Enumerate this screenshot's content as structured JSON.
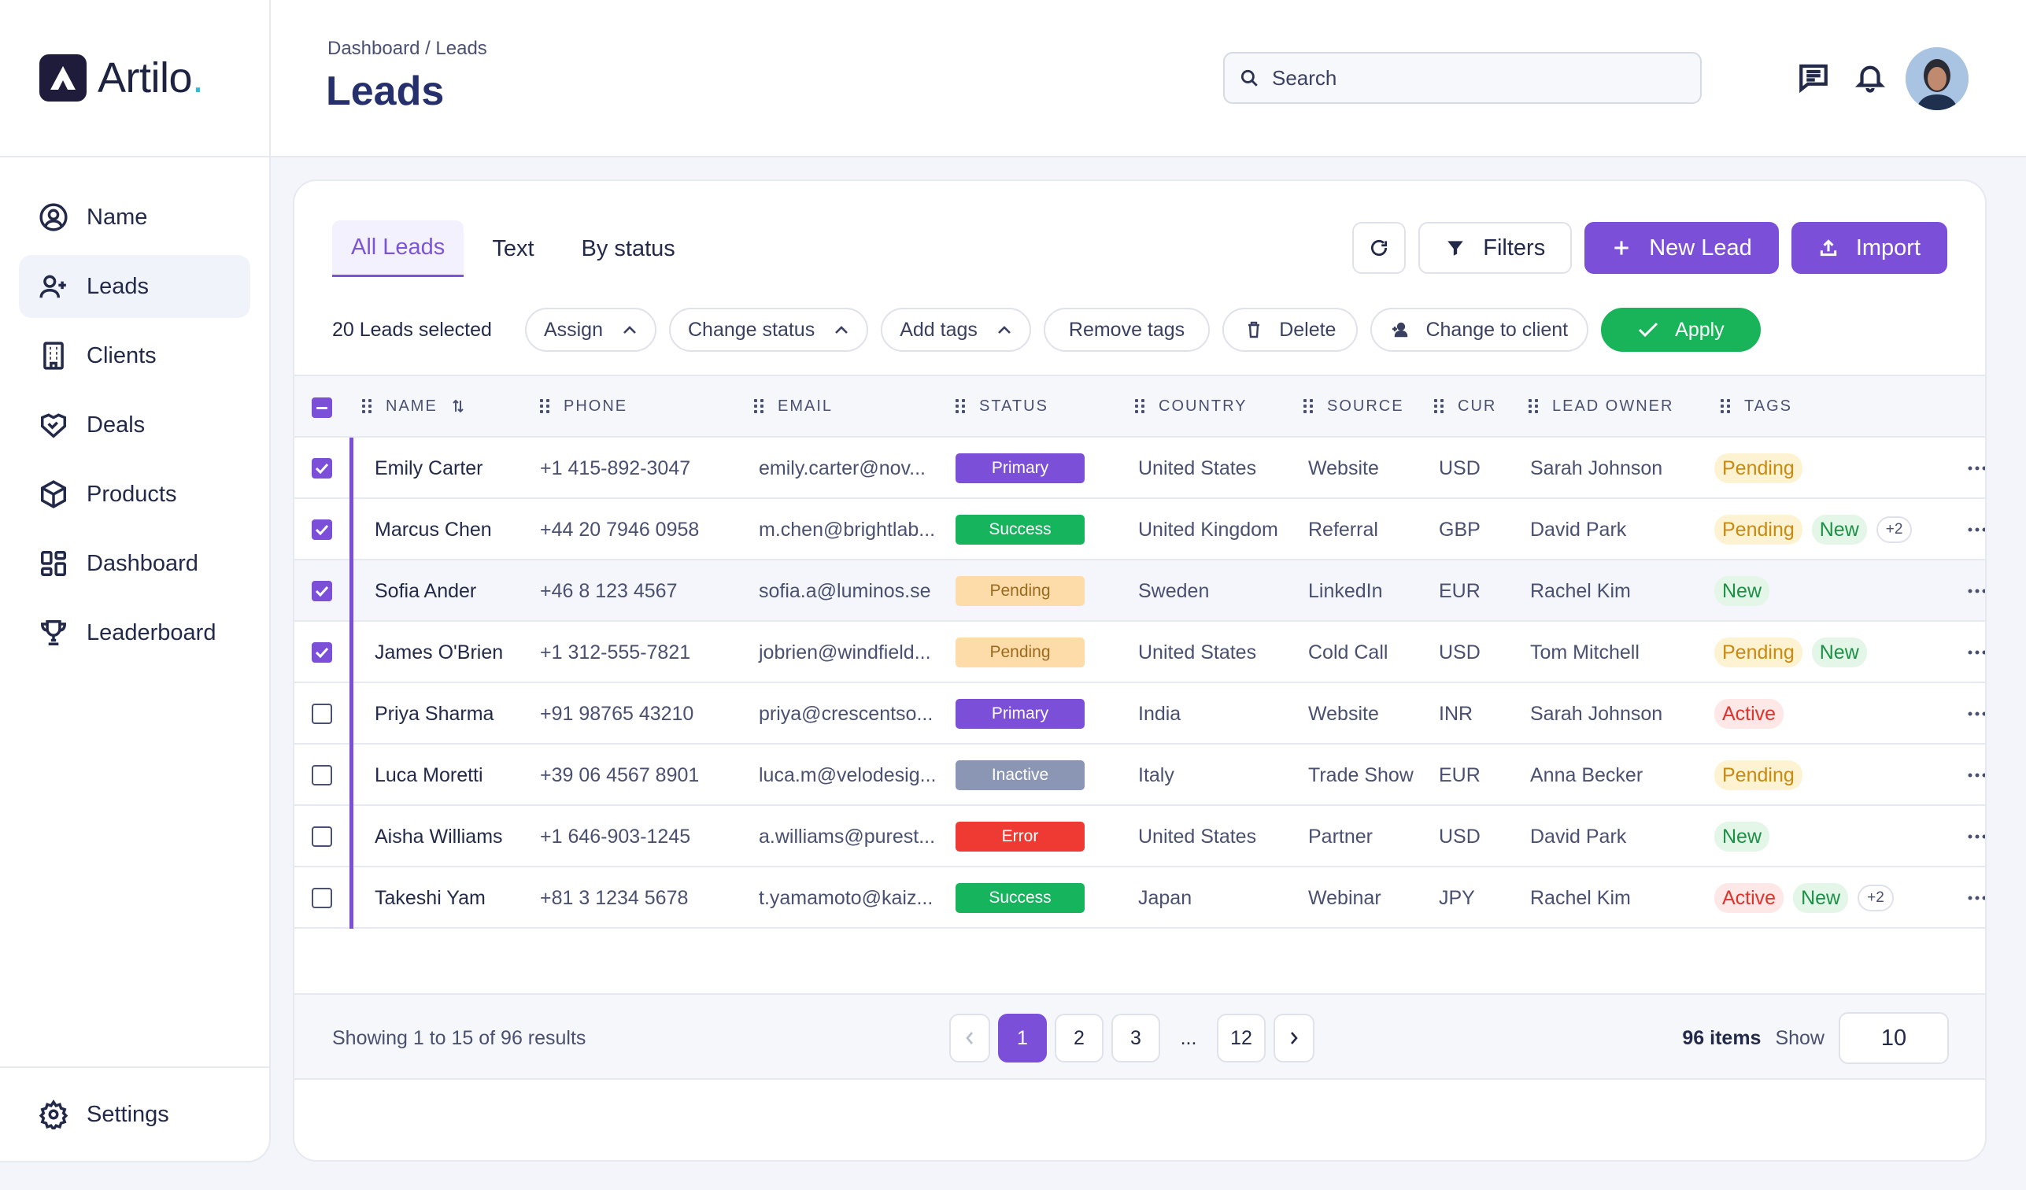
{
  "app": {
    "name": "Artilo",
    "dot": "."
  },
  "sidebar": {
    "items": [
      {
        "label": "Name",
        "icon": "user-circle-icon"
      },
      {
        "label": "Leads",
        "icon": "user-plus-icon"
      },
      {
        "label": "Clients",
        "icon": "building-icon"
      },
      {
        "label": "Deals",
        "icon": "handshake-icon"
      },
      {
        "label": "Products",
        "icon": "box-icon"
      },
      {
        "label": "Dashboard",
        "icon": "grid-icon"
      },
      {
        "label": "Leaderboard",
        "icon": "trophy-icon"
      }
    ],
    "active": "Leads",
    "settings": "Settings"
  },
  "header": {
    "breadcrumb": "Dashboard / Leads",
    "title": "Leads",
    "search_placeholder": "Search"
  },
  "tabs": [
    "All Leads",
    "Text",
    "By status"
  ],
  "toolbar": {
    "filters": "Filters",
    "new_lead": "New Lead",
    "import": "Import"
  },
  "bulk": {
    "selected": "20 Leads selected",
    "assign": "Assign",
    "change_status": "Change status",
    "add_tags": "Add tags",
    "remove_tags": "Remove tags",
    "delete": "Delete",
    "change_to_client": "Change to client",
    "apply": "Apply"
  },
  "table": {
    "columns": [
      "NAME",
      "PHONE",
      "EMAIL",
      "STATUS",
      "COUNTRY",
      "SOURCE",
      "CUR",
      "LEAD OWNER",
      "TAGS"
    ],
    "rows": [
      {
        "checked": true,
        "name": "Emily Carter",
        "phone": "+1 415-892-3047",
        "email": "emily.carter@nov...",
        "status": "Primary",
        "country": "United States",
        "source": "Website",
        "cur": "USD",
        "owner": "Sarah Johnson",
        "tags": [
          "Pending"
        ],
        "more": ""
      },
      {
        "checked": true,
        "name": "Marcus Chen",
        "phone": "+44 20 7946 0958",
        "email": "m.chen@brightlab...",
        "status": "Success",
        "country": "United Kingdom",
        "source": "Referral",
        "cur": "GBP",
        "owner": "David Park",
        "tags": [
          "Pending",
          "New"
        ],
        "more": "+2"
      },
      {
        "checked": true,
        "name": "Sofia Ander",
        "phone": "+46 8 123 4567",
        "email": "sofia.a@luminos.se",
        "status": "Pending",
        "country": "Sweden",
        "source": "LinkedIn",
        "cur": "EUR",
        "owner": "Rachel Kim",
        "tags": [
          "New"
        ],
        "more": ""
      },
      {
        "checked": true,
        "name": "James O'Brien",
        "phone": "+1 312-555-7821",
        "email": "jobrien@windfield...",
        "status": "Pending",
        "country": "United States",
        "source": "Cold Call",
        "cur": "USD",
        "owner": "Tom Mitchell",
        "tags": [
          "Pending",
          "New"
        ],
        "more": ""
      },
      {
        "checked": false,
        "name": "Priya Sharma",
        "phone": "+91 98765 43210",
        "email": "priya@crescentso...",
        "status": "Primary",
        "country": "India",
        "source": "Website",
        "cur": "INR",
        "owner": "Sarah Johnson",
        "tags": [
          "Active"
        ],
        "more": ""
      },
      {
        "checked": false,
        "name": "Luca Moretti",
        "phone": "+39 06 4567 8901",
        "email": "luca.m@velodesig...",
        "status": "Inactive",
        "country": "Italy",
        "source": "Trade Show",
        "cur": "EUR",
        "owner": "Anna Becker",
        "tags": [
          "Pending"
        ],
        "more": ""
      },
      {
        "checked": false,
        "name": "Aisha Williams",
        "phone": "+1 646-903-1245",
        "email": "a.williams@purest...",
        "status": "Error",
        "country": "United States",
        "source": "Partner",
        "cur": "USD",
        "owner": "David Park",
        "tags": [
          "New"
        ],
        "more": ""
      },
      {
        "checked": false,
        "name": "Takeshi Yam",
        "phone": "+81 3 1234 5678",
        "email": "t.yamamoto@kaiz...",
        "status": "Success",
        "country": "Japan",
        "source": "Webinar",
        "cur": "JPY",
        "owner": "Rachel Kim",
        "tags": [
          "Active",
          "New"
        ],
        "more": "+2"
      }
    ]
  },
  "footer": {
    "showing": "Showing 1 to 15 of 96 results",
    "pages": [
      "1",
      "2",
      "3",
      "...",
      "12"
    ],
    "current_page": "1",
    "items": "96 items",
    "show_label": "Show",
    "page_size": "10"
  },
  "colors": {
    "accent": "#7b4fd8",
    "success": "#16b45d",
    "error": "#ee3a32",
    "title": "#26306c"
  }
}
